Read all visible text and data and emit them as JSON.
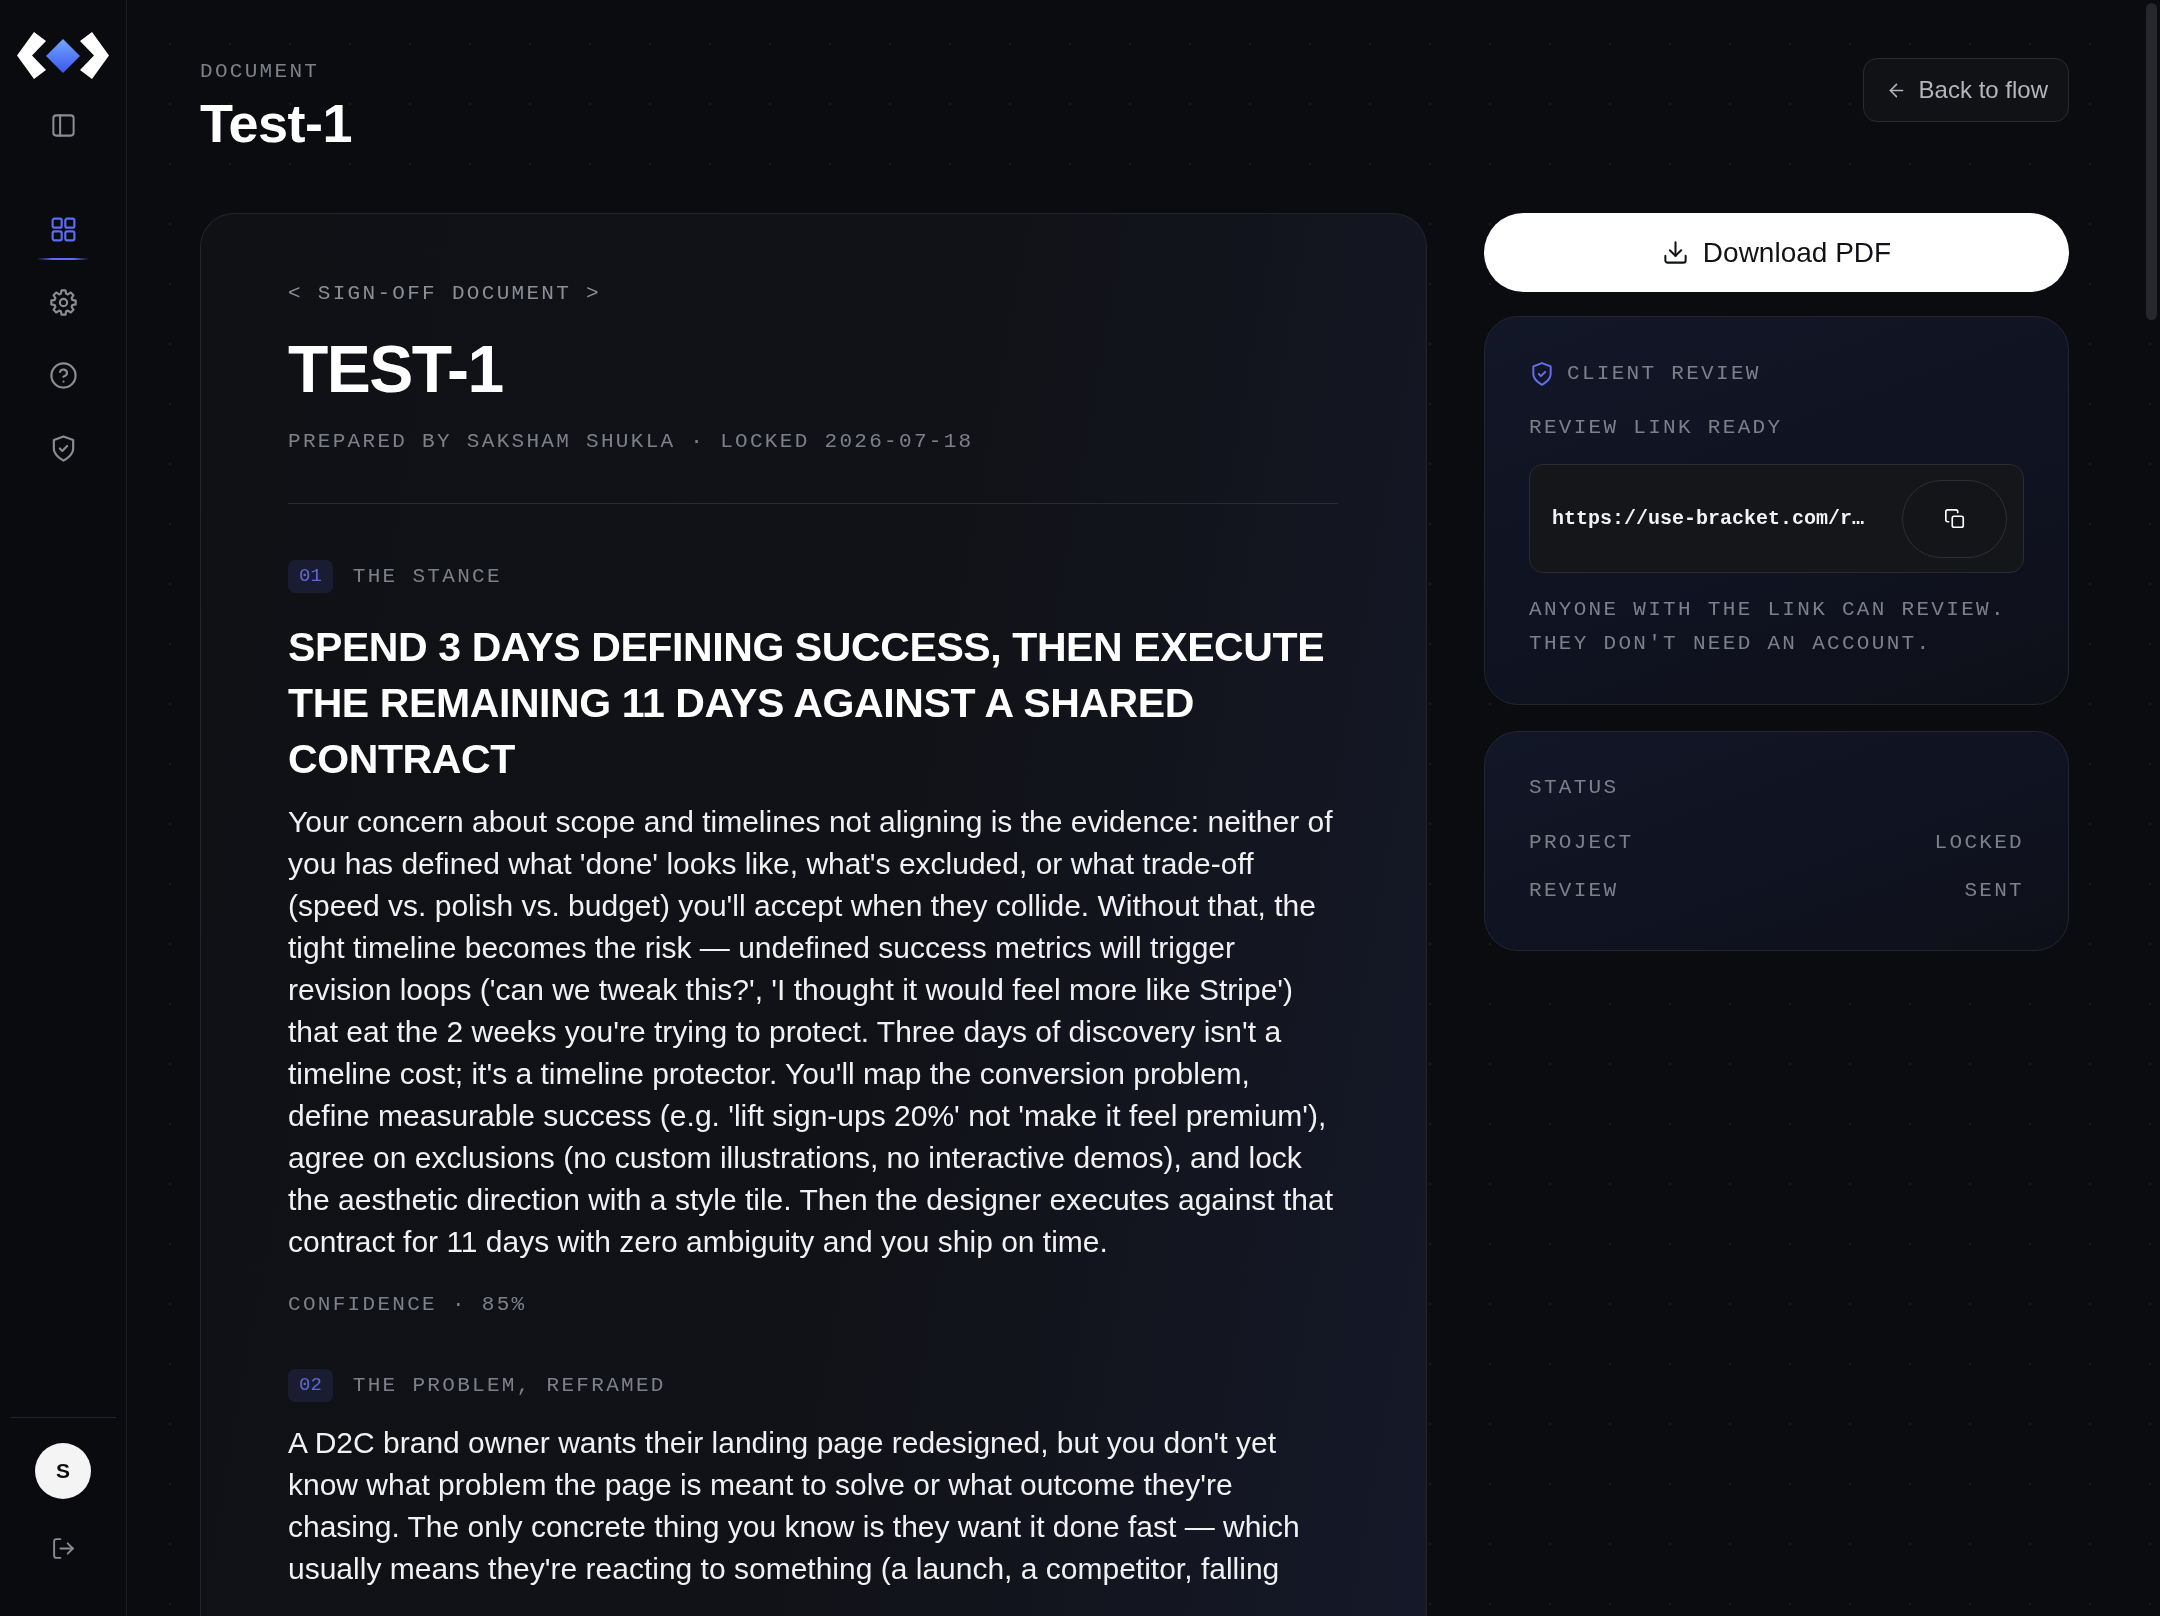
{
  "sidebar": {
    "nav": [
      {
        "selected": true
      },
      {
        "selected": false
      },
      {
        "selected": false
      },
      {
        "selected": false
      }
    ],
    "avatar": "S"
  },
  "header": {
    "eyebrow": "DOCUMENT",
    "title": "Test-1",
    "back_button": "Back to flow"
  },
  "document": {
    "eyebrow": "< SIGN-OFF DOCUMENT >",
    "title": "TEST-1",
    "meta": "PREPARED BY SAKSHAM SHUKLA · LOCKED 2026-07-18",
    "sections": [
      {
        "number": "01",
        "label": "THE STANCE",
        "heading": "SPEND 3 DAYS DEFINING SUCCESS, THEN EXECUTE THE REMAINING 11 DAYS AGAINST A SHARED CONTRACT",
        "body": "Your concern about scope and timelines not aligning is the evidence: neither of you has defined what 'done' looks like, what's excluded, or what trade-off (speed vs. polish vs. budget) you'll accept when they collide. Without that, the tight timeline becomes the risk — undefined success metrics will trigger revision loops ('can we tweak this?', 'I thought it would feel more like Stripe') that eat the 2 weeks you're trying to protect. Three days of discovery isn't a timeline cost; it's a timeline protector. You'll map the conversion problem, define measurable success (e.g. 'lift sign-ups 20%' not 'make it feel premium'), agree on exclusions (no custom illustrations, no interactive demos), and lock the aesthetic direction with a style tile. Then the designer executes against that contract for 11 days with zero ambiguity and you ship on time.",
        "confidence": "CONFIDENCE · 85%"
      },
      {
        "number": "02",
        "label": "THE PROBLEM, REFRAMED",
        "body": "A D2C brand owner wants their landing page redesigned, but you don't yet know what problem the page is meant to solve or what outcome they're chasing. The only concrete thing you know is they want it done fast — which usually means they're reacting to something (a launch, a competitor, falling"
      }
    ]
  },
  "download_button": "Download PDF",
  "client_review": {
    "title": "CLIENT REVIEW",
    "subtitle": "REVIEW LINK READY",
    "link": "https://use-bracket.com/r…",
    "note": "ANYONE WITH THE LINK CAN REVIEW. THEY DON'T NEED AN ACCOUNT."
  },
  "status": {
    "title": "STATUS",
    "rows": [
      {
        "label": "PROJECT",
        "value": "LOCKED"
      },
      {
        "label": "REVIEW",
        "value": "SENT"
      }
    ]
  }
}
